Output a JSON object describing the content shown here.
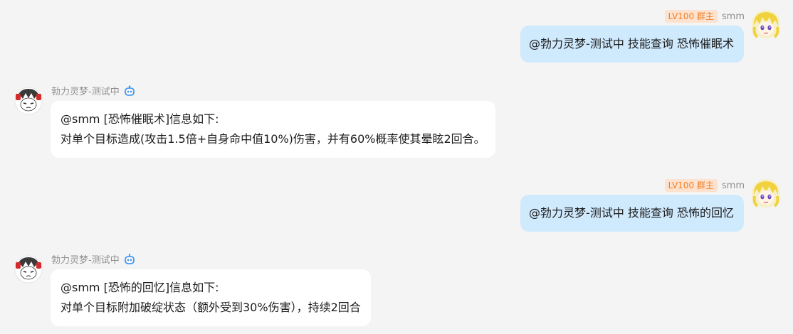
{
  "colors": {
    "background": "#f4f4f4",
    "outgoing_bubble": "#cfe9fd",
    "incoming_bubble": "#ffffff",
    "badge_bg": "#fde3cf",
    "badge_text": "#f07f28",
    "bot_icon": "#2e8ff5"
  },
  "messages": [
    {
      "direction": "outgoing",
      "badge": "LV100 群主",
      "sender": "smm",
      "avatar_icon": "yellow-hair-anime-avatar",
      "text": "@勃力灵梦-测试中 技能查询 恐怖催眠术"
    },
    {
      "direction": "incoming",
      "sender": "勃力灵梦-测试中",
      "bot_icon": "robot-icon",
      "avatar_icon": "reimu-bot-avatar",
      "line1": "@smm [恐怖催眠术]信息如下:",
      "line2": "对单个目标造成(攻击1.5倍+自身命中值10%)伤害，并有60%概率使其晕眩2回合。"
    },
    {
      "direction": "outgoing",
      "badge": "LV100 群主",
      "sender": "smm",
      "avatar_icon": "yellow-hair-anime-avatar",
      "text": "@勃力灵梦-测试中 技能查询 恐怖的回忆"
    },
    {
      "direction": "incoming",
      "sender": "勃力灵梦-测试中",
      "bot_icon": "robot-icon",
      "avatar_icon": "reimu-bot-avatar",
      "line1": "@smm [恐怖的回忆]信息如下:",
      "line2": "对单个目标附加破绽状态（额外受到30%伤害），持续2回合"
    }
  ]
}
